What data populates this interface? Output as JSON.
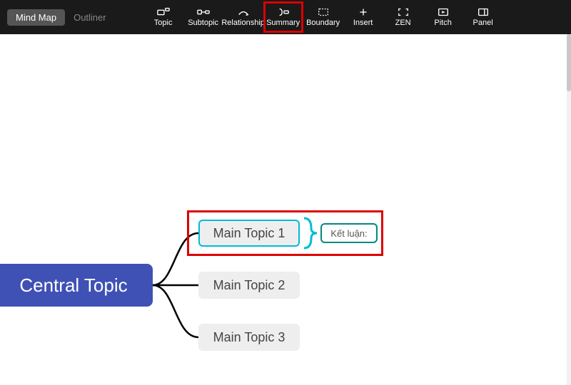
{
  "viewToggle": {
    "mindmap": "Mind Map",
    "outliner": "Outliner"
  },
  "toolbar": {
    "items": [
      {
        "label": "Topic"
      },
      {
        "label": "Subtopic"
      },
      {
        "label": "Relationship"
      },
      {
        "label": "Summary",
        "highlighted": true
      },
      {
        "label": "Boundary"
      },
      {
        "label": "Insert"
      },
      {
        "label": "ZEN"
      },
      {
        "label": "Pitch"
      },
      {
        "label": "Panel"
      }
    ]
  },
  "central": "Central Topic",
  "nodes": [
    {
      "label": "Main Topic 1",
      "selected": true
    },
    {
      "label": "Main Topic 2"
    },
    {
      "label": "Main Topic 3"
    }
  ],
  "summary": "Kết luận:"
}
